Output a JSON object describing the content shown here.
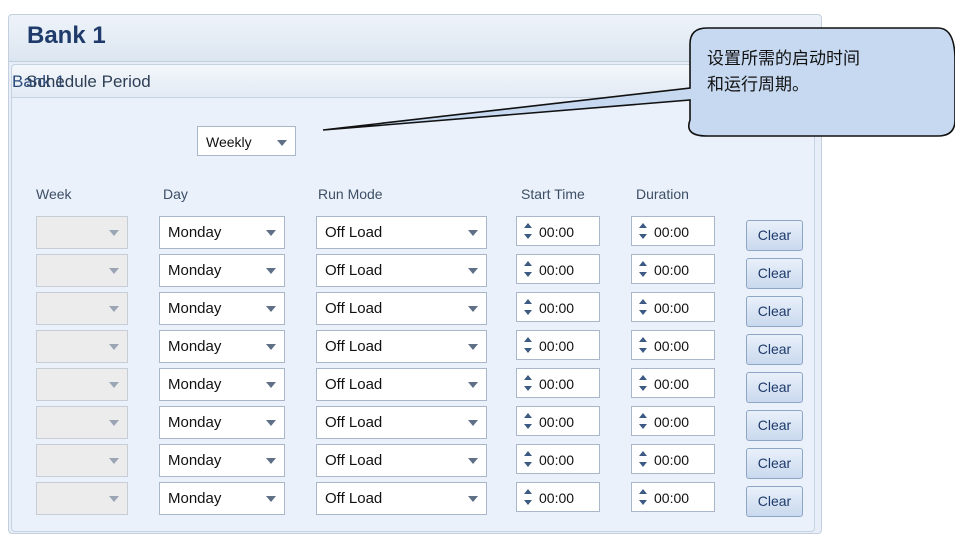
{
  "panel": {
    "title": "Bank 1"
  },
  "group": {
    "title": "Bank 1"
  },
  "schedule_period": {
    "label": "Schedule Period",
    "value": "Weekly"
  },
  "columns": {
    "week": "Week",
    "day": "Day",
    "run_mode": "Run Mode",
    "start_time": "Start Time",
    "duration": "Duration"
  },
  "rows": [
    {
      "week": "",
      "day": "Monday",
      "run_mode": "Off Load",
      "start_time": "00:00",
      "duration": "00:00",
      "clear": "Clear"
    },
    {
      "week": "",
      "day": "Monday",
      "run_mode": "Off Load",
      "start_time": "00:00",
      "duration": "00:00",
      "clear": "Clear"
    },
    {
      "week": "",
      "day": "Monday",
      "run_mode": "Off Load",
      "start_time": "00:00",
      "duration": "00:00",
      "clear": "Clear"
    },
    {
      "week": "",
      "day": "Monday",
      "run_mode": "Off Load",
      "start_time": "00:00",
      "duration": "00:00",
      "clear": "Clear"
    },
    {
      "week": "",
      "day": "Monday",
      "run_mode": "Off Load",
      "start_time": "00:00",
      "duration": "00:00",
      "clear": "Clear"
    },
    {
      "week": "",
      "day": "Monday",
      "run_mode": "Off Load",
      "start_time": "00:00",
      "duration": "00:00",
      "clear": "Clear"
    },
    {
      "week": "",
      "day": "Monday",
      "run_mode": "Off Load",
      "start_time": "00:00",
      "duration": "00:00",
      "clear": "Clear"
    },
    {
      "week": "",
      "day": "Monday",
      "run_mode": "Off Load",
      "start_time": "00:00",
      "duration": "00:00",
      "clear": "Clear"
    }
  ],
  "callout": {
    "line1": "设置所需的启动时间",
    "line2": "和运行周期。"
  }
}
